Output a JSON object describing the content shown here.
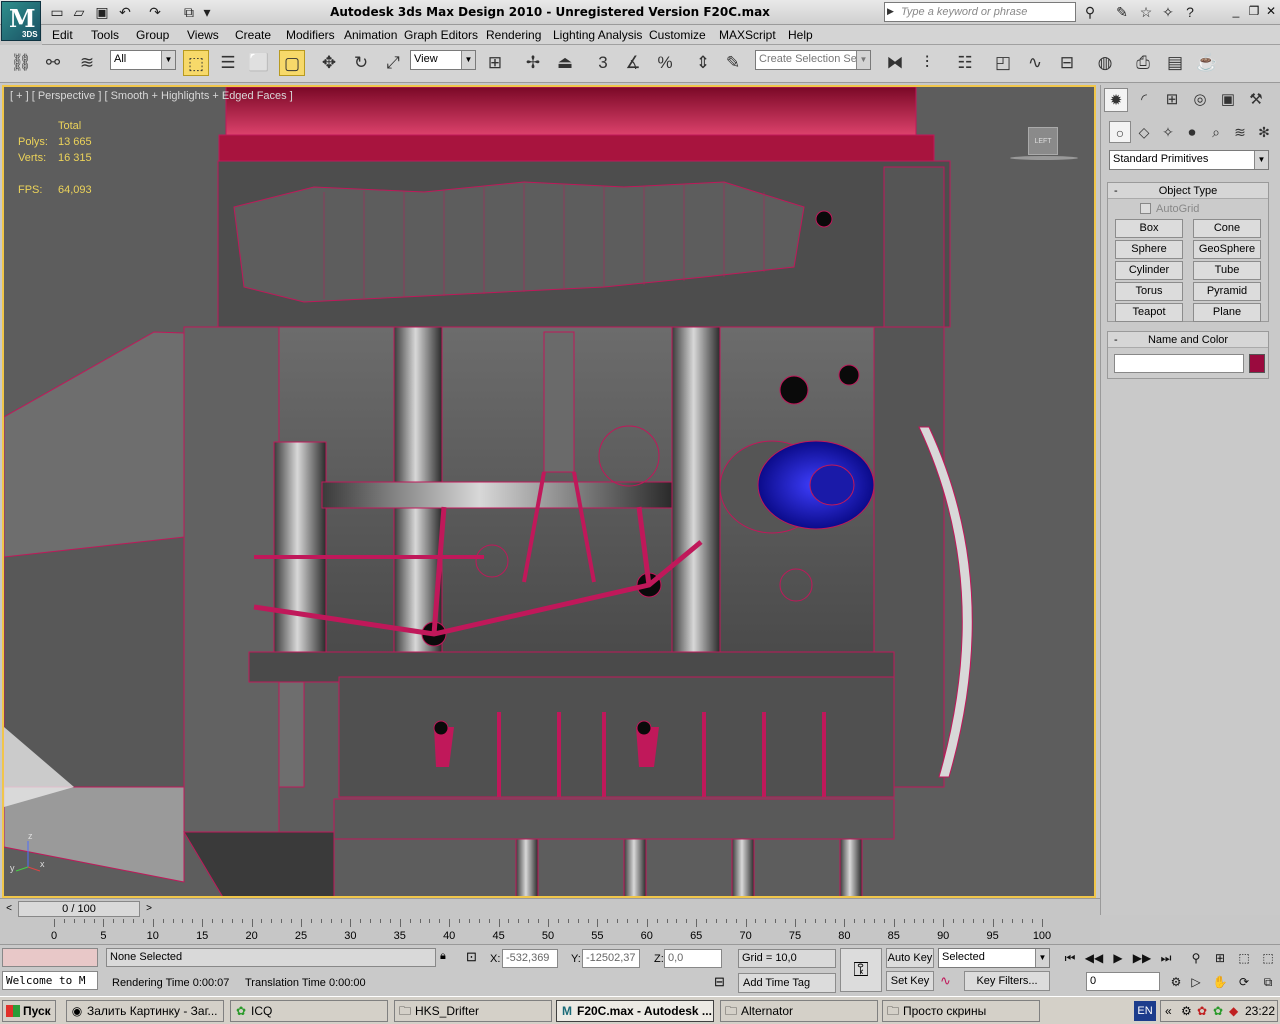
{
  "title_bar": {
    "app_title": "Autodesk 3ds Max Design 2010  - Unregistered Version    F20C.max",
    "search_placeholder": "Type a keyword or phrase",
    "logo_version": "3DS"
  },
  "menu": [
    "Edit",
    "Tools",
    "Group",
    "Views",
    "Create",
    "Modifiers",
    "Animation",
    "Graph Editors",
    "Rendering",
    "Lighting Analysis",
    "Customize",
    "MAXScript",
    "Help"
  ],
  "toolbar": {
    "selection_filter": "All",
    "reference_coord": "View",
    "named_selection_placeholder": "Create Selection Se",
    "snap_labels": [
      "3",
      "%"
    ]
  },
  "viewport": {
    "label": "[ + ] [ Perspective ] [ Smooth + Highlights + Edged Faces ]",
    "stats": {
      "header": "Total",
      "polys_label": "Polys:",
      "polys_value": "13 665",
      "verts_label": "Verts:",
      "verts_value": "16 315",
      "fps_label": "FPS:",
      "fps_value": "64,093"
    },
    "viewcube_label": "LEFT",
    "axis_labels": [
      "z",
      "x",
      "y"
    ]
  },
  "command_panel": {
    "category": "Standard Primitives",
    "object_type_title": "Object Type",
    "autogrid_label": "AutoGrid",
    "primitives": [
      "Box",
      "Cone",
      "Sphere",
      "GeoSphere",
      "Cylinder",
      "Tube",
      "Torus",
      "Pyramid",
      "Teapot",
      "Plane"
    ],
    "name_color_title": "Name and Color",
    "object_color": "#9a0a3e"
  },
  "timeline": {
    "slider_label": "0 / 100",
    "ruler_labels": [
      "0",
      "5",
      "10",
      "15",
      "20",
      "25",
      "30",
      "35",
      "40",
      "45",
      "50",
      "55",
      "60",
      "65",
      "70",
      "75",
      "80",
      "85",
      "90",
      "95",
      "100"
    ]
  },
  "status": {
    "maxscript_listener": "Welcome to M",
    "selection_status": "None Selected",
    "rendering_time": "Rendering Time  0:00:07",
    "translation_time": "Translation Time  0:00:00",
    "x_label": "X:",
    "x_value": "-532,369",
    "y_label": "Y:",
    "y_value": "-12502,37",
    "z_label": "Z:",
    "z_value": "0,0",
    "grid": "Grid = 10,0",
    "add_time_tag": "Add Time Tag",
    "auto_key": "Auto Key",
    "set_key": "Set Key",
    "key_mode_selected": "Selected",
    "key_filters": "Key Filters...",
    "current_frame": "0"
  },
  "taskbar": {
    "start_label": "Пуск",
    "tasks": [
      "Залить Картинку - Заг...",
      "ICQ",
      "HKS_Drifter",
      "F20C.max - Autodesk ...",
      "Alternator",
      "Просто скрины"
    ],
    "language": "EN",
    "clock": "23:22"
  },
  "colors": {
    "accent": "#f0c64a",
    "wire": "#c0185a",
    "engine_top": "#8a0a2e"
  }
}
